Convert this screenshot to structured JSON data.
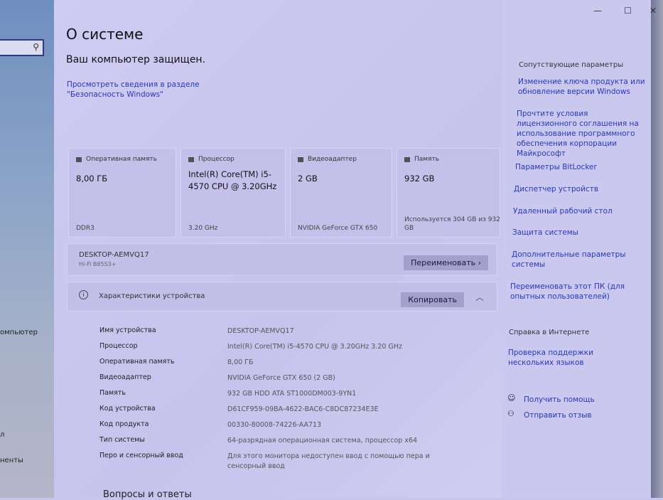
{
  "sidebar": {
    "items": [
      "омпьютер",
      "л",
      "ненты"
    ]
  },
  "window": {
    "minimize": "—",
    "maximize": "☐",
    "close": "✕"
  },
  "page": {
    "title": "О системе",
    "protected": "Ваш компьютер защищен.",
    "security_link": "Просмотреть сведения в разделе \"Безопасность Windows\""
  },
  "cards": [
    {
      "title": "Оперативная память",
      "value": "8,00 ГБ",
      "sub": "DDR3"
    },
    {
      "title": "Процессор",
      "value": "Intel(R) Core(TM) i5-4570 CPU @ 3.20GHz",
      "sub": "3.20 GHz"
    },
    {
      "title": "Видеоадаптер",
      "value": "2 GB",
      "sub": "NVIDIA GeForce GTX 650"
    },
    {
      "title": "Память",
      "value": "932 GB",
      "sub": "Используется 304 GB из 932 GB"
    }
  ],
  "pc": {
    "name": "DESKTOP-AEMVQ17",
    "sub": "Hi-Fi B85S3+",
    "rename": "Переименовать ›"
  },
  "specs": {
    "title": "Характеристики устройства",
    "copy": "Копировать",
    "rows": [
      {
        "k": "Имя устройства",
        "v": "DESKTOP-AEMVQ17"
      },
      {
        "k": "Процессор",
        "v": "Intel(R) Core(TM) i5-4570 CPU @ 3.20GHz   3.20 GHz"
      },
      {
        "k": "Оперативная память",
        "v": "8,00 ГБ"
      },
      {
        "k": "Видеоадаптер",
        "v": "NVIDIA GeForce GTX 650 (2 GB)"
      },
      {
        "k": "Память",
        "v": "932 GB HDD ATA ST1000DM003-9YN1"
      },
      {
        "k": "Код устройства",
        "v": "D61CF959-09BA-4622-BAC6-C8DC87234E3E"
      },
      {
        "k": "Код продукта",
        "v": "00330-80008-74226-AA713"
      },
      {
        "k": "Тип системы",
        "v": "64-разрядная операционная система, процессор x64"
      },
      {
        "k": "Перо и сенсорный ввод",
        "v": "Для этого монитора недоступен ввод с помощью пера и сенсорный ввод"
      }
    ]
  },
  "faq": "Вопросы и ответы",
  "related": {
    "title": "Сопутствующие параметры",
    "links": [
      "Изменение ключа продукта или обновление версии Windows",
      "Прочтите условия лицензионного соглашения на использование программного обеспечения корпорации Майкрософт",
      "Параметры BitLocker",
      "Диспетчер устройств",
      "Удаленный рабочий стол",
      "Защита системы",
      "Дополнительные параметры системы",
      "Переименовать этот ПК (для опытных пользователей)"
    ]
  },
  "web": {
    "title": "Справка в Интернете",
    "link": "Проверка поддержки нескольких языков"
  },
  "help": {
    "get_help": "Получить помощь",
    "feedback": "Отправить отзыв"
  }
}
